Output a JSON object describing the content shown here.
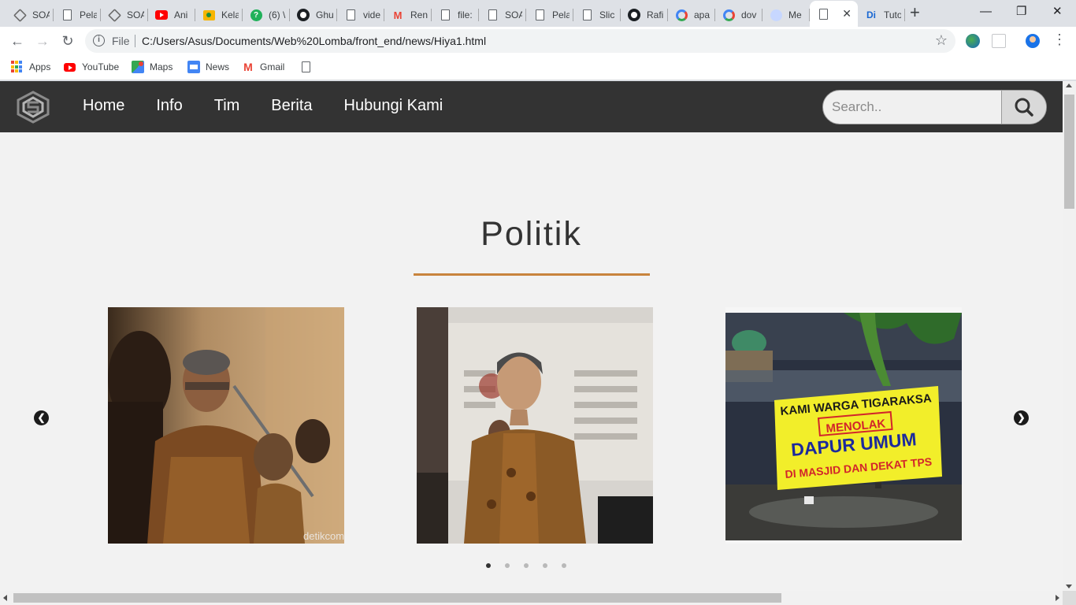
{
  "browser": {
    "tabs": [
      {
        "title": "SOA",
        "icon": "soa-icon"
      },
      {
        "title": "Pela",
        "icon": "document-icon"
      },
      {
        "title": "SOA",
        "icon": "soa-icon"
      },
      {
        "title": "Ani",
        "icon": "youtube-icon"
      },
      {
        "title": "Kela",
        "icon": "classroom-icon"
      },
      {
        "title": "(6) \\",
        "icon": "question-icon"
      },
      {
        "title": "Ghu",
        "icon": "github-icon"
      },
      {
        "title": "vide",
        "icon": "document-icon"
      },
      {
        "title": "Ren",
        "icon": "gmail-icon"
      },
      {
        "title": "file:",
        "icon": "document-icon"
      },
      {
        "title": "SOA",
        "icon": "document-icon"
      },
      {
        "title": "Pela",
        "icon": "document-icon"
      },
      {
        "title": "Slic",
        "icon": "document-icon"
      },
      {
        "title": "Rafi",
        "icon": "github-icon"
      },
      {
        "title": "apa",
        "icon": "google-icon"
      },
      {
        "title": "dov",
        "icon": "google-icon"
      },
      {
        "title": "Me",
        "icon": "wave-icon"
      },
      {
        "title": "",
        "icon": "document-icon",
        "active": true
      },
      {
        "title": "Tuto",
        "icon": "di-icon"
      }
    ],
    "di_favicon_text": "Di",
    "url_scheme": "File",
    "url": "C:/Users/Asus/Documents/Web%20Lomba/front_end/news/Hiya1.html",
    "bookmarks": [
      {
        "label": "Apps",
        "icon": "apps-grid-icon"
      },
      {
        "label": "YouTube",
        "icon": "youtube-icon"
      },
      {
        "label": "Maps",
        "icon": "maps-icon"
      },
      {
        "label": "News",
        "icon": "news-icon"
      },
      {
        "label": "Gmail",
        "icon": "gmail-icon"
      },
      {
        "label": "",
        "icon": "document-icon"
      }
    ]
  },
  "site": {
    "nav_links": [
      "Home",
      "Info",
      "Tim",
      "Berita",
      "Hubungi Kami"
    ],
    "search_placeholder": "Search..",
    "section_title": "Politik",
    "carousel": {
      "active_slide": 1,
      "slide_count": 5,
      "cards": [
        {
          "name": "news-card-1",
          "watermark": "detikcom"
        },
        {
          "name": "news-card-2",
          "watermark": ""
        },
        {
          "name": "news-card-3",
          "banner_lines": [
            "KAMI WARGA TIGARAKSA",
            "MENOLAK",
            "DAPUR UMUM",
            "DI MASJID DAN DEKAT TPS"
          ]
        }
      ]
    }
  },
  "colors": {
    "navbar": "#333333",
    "accent_underline": "#c8843d",
    "page_bg": "#f2f2f2"
  }
}
